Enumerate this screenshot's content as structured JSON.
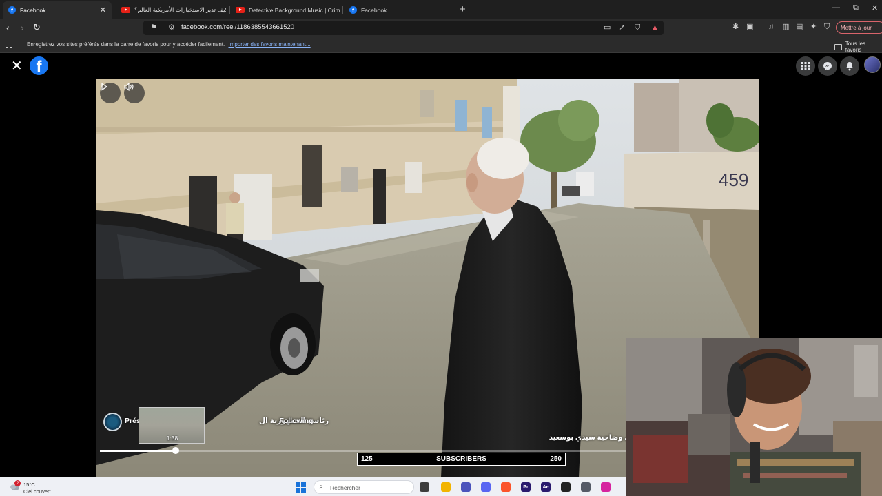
{
  "browser": {
    "tabs": [
      {
        "title": "Facebook",
        "icon": "facebook-icon",
        "active": true
      },
      {
        "title": "كيف تدير الاستخبارات الأمريكية العالم؟ |",
        "icon": "youtube-icon",
        "active": false
      },
      {
        "title": "Detective Background Music | Crime",
        "icon": "youtube-icon",
        "active": false
      },
      {
        "title": "Facebook",
        "icon": "facebook-icon",
        "active": false
      }
    ],
    "tab_close_glyph": "✕",
    "new_tab_glyph": "+",
    "url": "facebook.com/reel/1186385543661520",
    "update_button": "Mettre à jour",
    "bookmarks_bar": {
      "message": "Enregistrez vos sites préférés dans la barre de favoris pour y accéder facilement.",
      "import_link": "Importer des favoris maintenant...",
      "all_bookmarks": "Tous les favoris"
    }
  },
  "facebook": {
    "logo_letter": "f",
    "close_glyph": "✕",
    "reel": {
      "channel_name_latin": "Prés",
      "channel_name_arabic": "رئاسة الجمهورية ال",
      "follow_status": "· Following",
      "caption": "منطقة البحر الأزرق من معتمدية المرسى وضاحية سيدي بوسعيد",
      "wall_number": "459",
      "preview_time": "1:38",
      "progress_fraction": 0.116
    }
  },
  "overlay": {
    "subscribers_current": "125",
    "subscribers_label": "SUBSCRIBERS",
    "subscribers_goal": "250"
  },
  "taskbar": {
    "weather_badge": "2",
    "temperature": "15°C",
    "condition": "Ciel couvert",
    "search_placeholder": "Rechercher",
    "apps": [
      {
        "name": "file-explorer-icon",
        "color": "#f2b400",
        "label": ""
      },
      {
        "name": "teams-icon",
        "color": "#4b53bc",
        "label": ""
      },
      {
        "name": "discord-icon",
        "color": "#5865f2",
        "label": ""
      },
      {
        "name": "brave-icon",
        "color": "#fb542b",
        "label": ""
      },
      {
        "name": "premiere-icon",
        "color": "#2a1a6e",
        "label": "Pr"
      },
      {
        "name": "after-effects-icon",
        "color": "#2a1a6e",
        "label": "Ae"
      },
      {
        "name": "obs-icon",
        "color": "#222222",
        "label": ""
      },
      {
        "name": "calculator-icon",
        "color": "#555a66",
        "label": ""
      },
      {
        "name": "instagram-icon",
        "color": "#d6249f",
        "label": ""
      }
    ]
  },
  "colors": {
    "facebook_blue": "#1877f2",
    "youtube_red": "#e62117",
    "chrome_dark": "#2b2b2b"
  }
}
